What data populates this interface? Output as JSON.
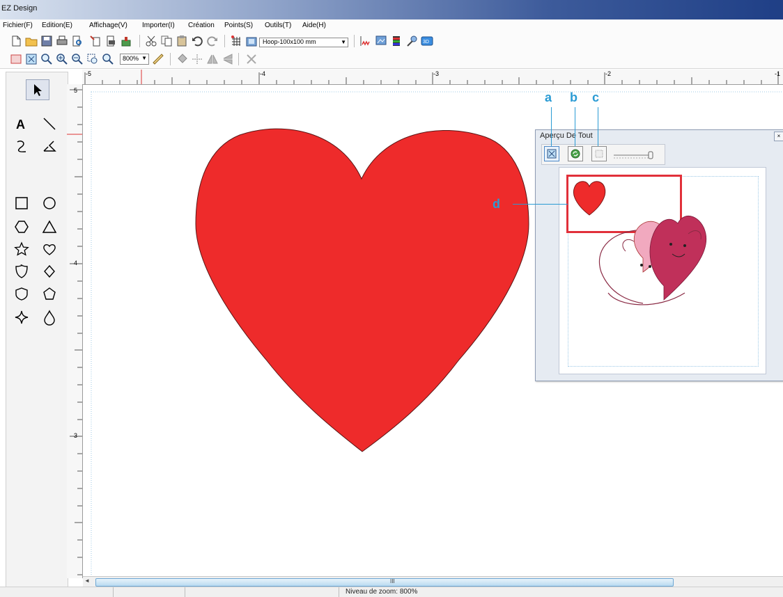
{
  "window": {
    "title": "EZ Design"
  },
  "menu": [
    "Fichier(F)",
    "Edition(E)",
    "Affichage(V)",
    "Importer(I)",
    "Création",
    "Points(S)",
    "Outils(T)",
    "Aide(H)"
  ],
  "toolbar": {
    "hoop_select": "Hoop-100x100 mm",
    "zoom_select": "800%"
  },
  "rulers": {
    "top": [
      "-5",
      "-4",
      "-3",
      "-2",
      "-1"
    ],
    "left": [
      "5",
      "4",
      "3"
    ]
  },
  "preview_panel": {
    "title": "Aperçu De Tout"
  },
  "callouts": {
    "a": "a",
    "b": "b",
    "c": "c",
    "d": "d"
  },
  "status": {
    "zoom_level": "Niveau de zoom: 800%"
  },
  "colors": {
    "heart": "#ee2b2b",
    "selection": "#e1303a",
    "callout": "#2a9bd4"
  },
  "icons": {
    "left_tools": [
      "pointer-icon",
      "text-icon",
      "line-icon",
      "curve-icon",
      "polyline-icon",
      "square-icon",
      "circle-icon",
      "hexagon-icon",
      "triangle-icon",
      "star-icon",
      "heart-icon",
      "shield-icon",
      "diamond-icon",
      "badge-icon",
      "pentagon-icon",
      "sparkle-icon",
      "drop-icon"
    ],
    "preview_tools": [
      "fit-view-icon",
      "refresh-icon",
      "show-stitches-icon",
      "zoom-slider-icon"
    ]
  }
}
